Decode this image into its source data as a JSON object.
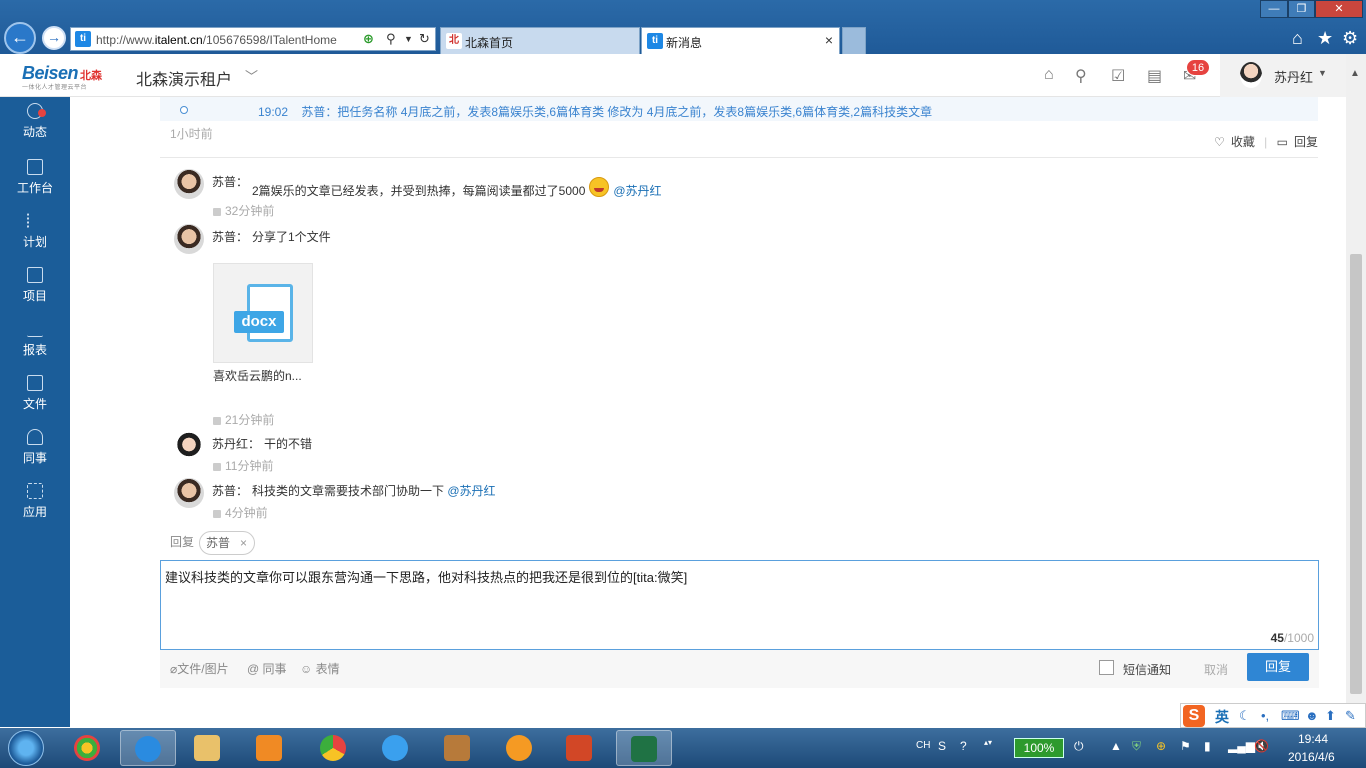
{
  "browser": {
    "back_glyph": "←",
    "forward_glyph": "→",
    "url_prefix": "http://www.",
    "url_domain": "italent.cn",
    "url_rest": "/105676598/ITalentHome",
    "address_badge": "ti",
    "tabs": [
      {
        "label": "北森首页",
        "icon": "北"
      },
      {
        "label": "新消息",
        "icon": "ti"
      }
    ],
    "tab_close": "×",
    "window_controls": [
      "—",
      "❐",
      "✕"
    ]
  },
  "header": {
    "logo_text": "Beisen",
    "logo_cn": "北森",
    "logo_slogan": "一体化人才管理云平台",
    "tenant": "北森演示租户",
    "tenant_caret": "﹀",
    "notification_count": "16",
    "user_name": "苏丹红",
    "user_caret": "▼"
  },
  "sidebar": {
    "items": [
      {
        "label": "动态"
      },
      {
        "label": "工作台"
      },
      {
        "label": "计划"
      },
      {
        "label": "项目"
      },
      {
        "label": "报表"
      },
      {
        "label": "文件"
      },
      {
        "label": "同事"
      },
      {
        "label": "应用"
      }
    ]
  },
  "timeline": {
    "time": "19:02",
    "text": "苏普：把任务名称 4月底之前，发表8篇娱乐类,6篇体育类 修改为 4月底之前，发表8篇娱乐类,6篇体育类,2篇科技类文章",
    "ago": "1小时前"
  },
  "actions": {
    "favorite": "收藏",
    "reply": "回复"
  },
  "comments": [
    {
      "author": "苏普：",
      "text": "2篇娱乐的文章已经发表，并受到热捧，每篇阅读量都过了5000",
      "mention": "@苏丹红",
      "time": "32分钟前"
    },
    {
      "author": "苏普：",
      "text": "分享了1个文件",
      "mention": "",
      "time": "21分钟前"
    },
    {
      "author": "苏丹红：",
      "text": "干的不错",
      "mention": "",
      "time": "11分钟前"
    },
    {
      "author": "苏普：",
      "text": "科技类的文章需要技术部门协助一下",
      "mention": "@苏丹红",
      "time": "4分钟前"
    }
  ],
  "file": {
    "type_label": "docx",
    "name": "喜欢岳云鹏的n..."
  },
  "reply": {
    "label": "回复",
    "chip": "苏普",
    "chip_close": "×",
    "editor_text": "建议科技类的文章你可以跟东营沟通一下思路，他对科技热点的把我还是很到位的[tita:微笑]",
    "count_current": "45",
    "count_max": "/1000",
    "toolbar": {
      "attach": "文件/图片",
      "colleague": "同事",
      "emoji": "表情",
      "sms": "短信通知",
      "cancel": "取消",
      "submit": "回复"
    }
  },
  "ime": {
    "logo": "S",
    "lang": "英"
  },
  "taskbar": {
    "tray_lang": "CH",
    "battery": "100%",
    "time": "19:44",
    "date": "2016/4/6"
  }
}
